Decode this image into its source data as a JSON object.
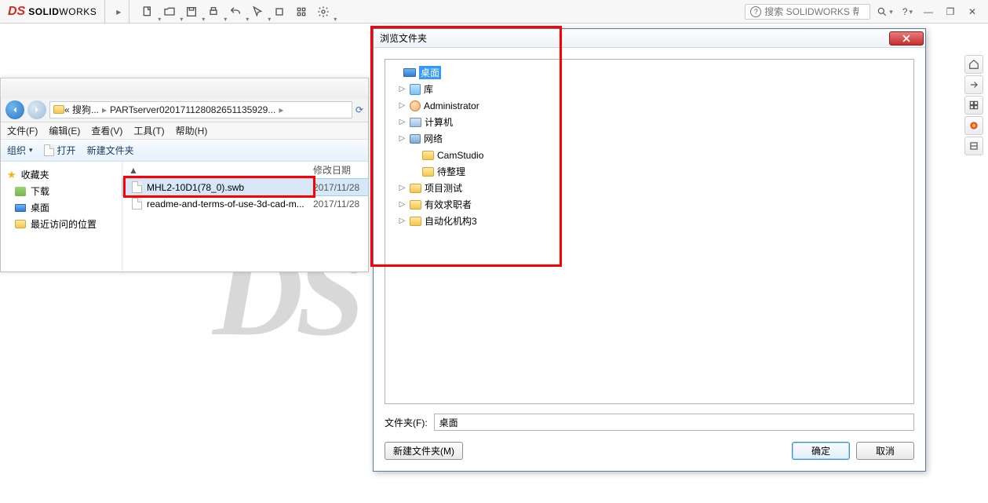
{
  "app": {
    "logo_solid": "SOLID",
    "logo_works": "WORKS",
    "search_placeholder": "搜索 SOLIDWORKS 帮助"
  },
  "explorer": {
    "breadcrumb_pre": "« 搜狗...",
    "breadcrumb_main": "PARTserver020171128082651135929...",
    "menu_file": "文件(F)",
    "menu_edit": "编辑(E)",
    "menu_view": "查看(V)",
    "menu_tools": "工具(T)",
    "menu_help": "帮助(H)",
    "tool_org": "组织",
    "tool_open": "打开",
    "tool_newfolder": "新建文件夹",
    "col_name_sort": "▲",
    "col_date": "修改日期",
    "fav_label": "收藏夹",
    "fav_dl": "下载",
    "fav_desktop": "桌面",
    "fav_recent": "最近访问的位置",
    "file1_name": "MHL2-10D1(78_0).swb",
    "file1_date": "2017/11/28",
    "file2_name": "readme-and-terms-of-use-3d-cad-m...",
    "file2_date": "2017/11/28"
  },
  "dialog": {
    "title": "浏览文件夹",
    "tree": {
      "desktop": "桌面",
      "library": "库",
      "admin": "Administrator",
      "computer": "计算机",
      "network": "网络",
      "camstudio": "CamStudio",
      "pending": "待整理",
      "projtest": "项目测试",
      "jobseeker": "有效求职者",
      "automation": "自动化机构3"
    },
    "field_label": "文件夹(F):",
    "field_value": "桌面",
    "btn_newfolder": "新建文件夹(M)",
    "btn_ok": "确定",
    "btn_cancel": "取消"
  }
}
